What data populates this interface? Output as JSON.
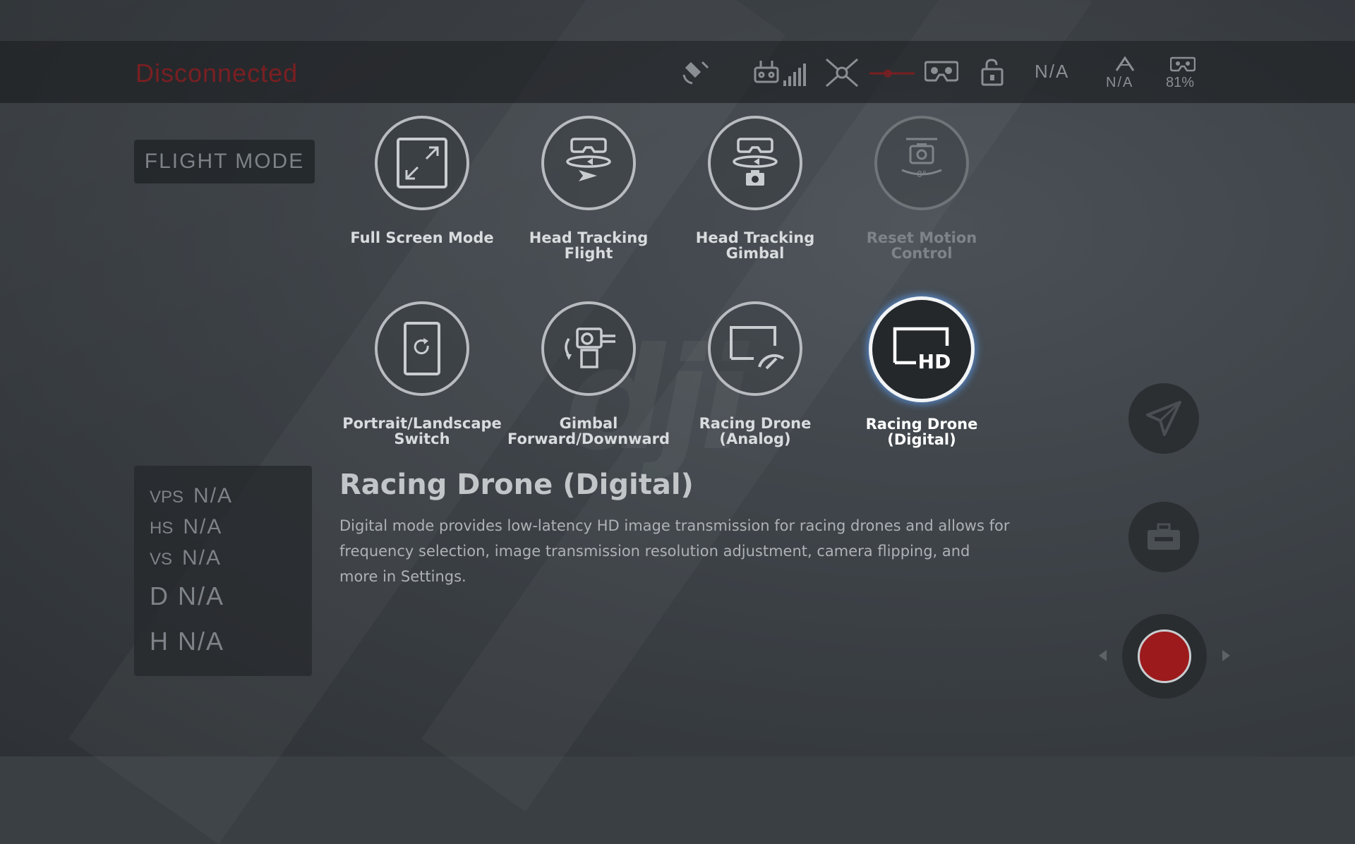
{
  "status": {
    "connection": "Disconnected",
    "signal_text": "N/A",
    "altitude_text": "N/A",
    "goggles_battery": "81%"
  },
  "flight_mode_label": "FLIGHT MODE",
  "telemetry": {
    "vps_label": "VPS",
    "vps_value": "N/A",
    "hs_label": "HS",
    "hs_value": "N/A",
    "vs_label": "VS",
    "vs_value": "N/A",
    "d_label": "D",
    "d_value": "N/A",
    "h_label": "H",
    "h_value": "N/A"
  },
  "modes": [
    {
      "label": "Full Screen Mode",
      "icon": "fullscreen-icon"
    },
    {
      "label": "Head Tracking\nFlight",
      "icon": "head-tracking-flight-icon"
    },
    {
      "label": "Head Tracking\nGimbal",
      "icon": "head-tracking-gimbal-icon"
    },
    {
      "label": "Reset Motion\nControl",
      "icon": "reset-motion-icon",
      "gauge_text": "0°"
    },
    {
      "label": "Portrait/Landscape\nSwitch",
      "icon": "portrait-landscape-icon"
    },
    {
      "label": "Gimbal\nForward/Downward",
      "icon": "gimbal-forward-icon"
    },
    {
      "label": "Racing Drone\n(Analog)",
      "icon": "racing-analog-icon"
    },
    {
      "label": "Racing Drone\n(Digital)",
      "icon": "racing-digital-icon",
      "badge": "HD"
    }
  ],
  "selected_mode": "Racing Drone (Digital)",
  "description": {
    "title": "Racing Drone (Digital)",
    "text": "Digital mode provides low-latency HD image transmission for racing drones and allows for frequency selection, image transmission resolution adjustment, camera flipping, and more in Settings."
  },
  "colors": {
    "accent_glow": "#5a96e6",
    "disconnected": "#7a1f22",
    "record": "#9c1a1c"
  },
  "watermark": "dji"
}
